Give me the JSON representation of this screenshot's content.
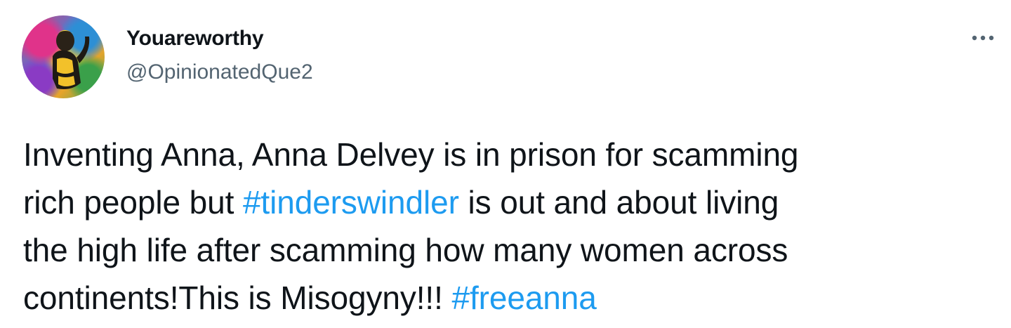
{
  "author": {
    "display_name": "Youareworthy",
    "handle": "@OpinionatedQue2",
    "avatar_icon": "profile-avatar-icon"
  },
  "more_menu": {
    "icon": "more-horizontal-icon"
  },
  "tweet": {
    "line1": "Inventing Anna, Anna Delvey is in prison for scamming",
    "line2_before": "rich people but ",
    "hashtag1": "#tinderswindler",
    "line2_after": " is out and about living",
    "line3": "the high life after scamming how many women across",
    "line4_before": "continents!This is Misogyny!!! ",
    "hashtag2": "#freeanna"
  },
  "colors": {
    "text": "#0f1419",
    "secondary": "#536471",
    "link": "#1d9bf0"
  }
}
